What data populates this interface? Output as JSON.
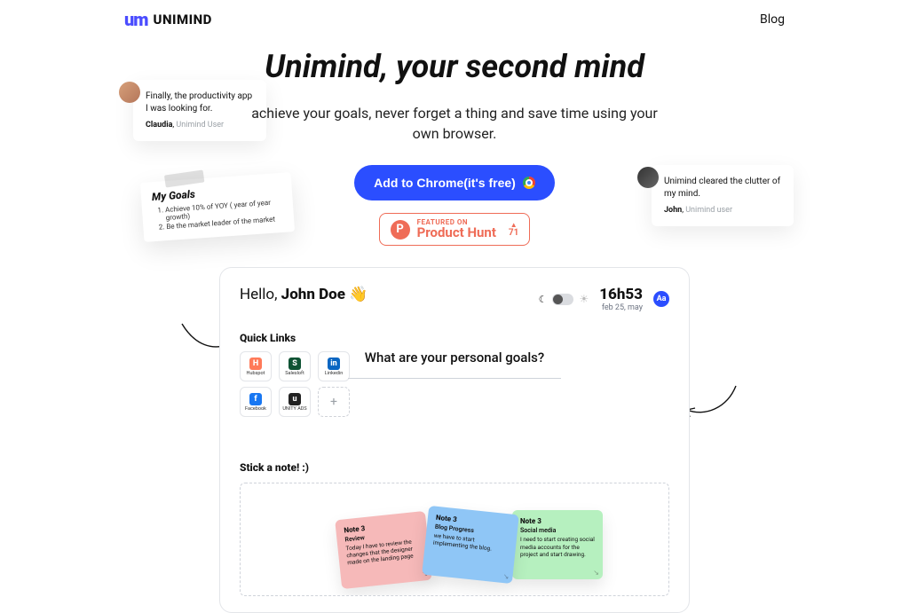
{
  "brand": {
    "icon": "um",
    "name": "UNIMIND"
  },
  "nav": {
    "blog": "Blog"
  },
  "hero": {
    "title": "Unimind, your second mind",
    "subtitle": "achieve your goals, never forget a thing and save time using your own browser.",
    "cta_label": "Add to Chrome(it's free)"
  },
  "product_hunt": {
    "featured_label": "FEATURED ON",
    "name": "Product Hunt",
    "votes": "71",
    "p": "P"
  },
  "testimonial_left": {
    "quote": "Finally, the productivity app I was looking for.",
    "author": "Claudia",
    "role": "Unimind User"
  },
  "testimonial_right": {
    "quote": "Unimind cleared the clutter of my mind.",
    "author": "John",
    "role": "Unimind user"
  },
  "goals_card": {
    "title": "My Goals",
    "items": [
      "Achieve 10% of YOY ( year of year growth)",
      "Be the market leader of the market"
    ]
  },
  "app": {
    "greeting_prefix": "Hello, ",
    "user_name": "John Doe",
    "wave": "👋",
    "time": "16h53",
    "date": "feb 25, may",
    "aa": "Aa",
    "quick_links_title": "Quick Links",
    "quick_links": [
      {
        "label": "Hubspot",
        "initial": "H",
        "color": "#ff7a59"
      },
      {
        "label": "Salesloft",
        "initial": "S",
        "color": "#0f5334"
      },
      {
        "label": "Linkedin",
        "initial": "in",
        "color": "#0a66c2"
      },
      {
        "label": "Facebook",
        "initial": "f",
        "color": "#1877f2"
      },
      {
        "label": "UNITY ADS",
        "initial": "u",
        "color": "#222"
      }
    ],
    "goals_question": "What are your personal goals?",
    "stick_title": "Stick a note! :)",
    "notes": [
      {
        "title": "Note 3",
        "subject": "Review",
        "body": "Today I have to review the changes that the designer made on the landing page"
      },
      {
        "title": "Note 3",
        "subject": "Blog Progress",
        "body": "we have to start implementing the blog."
      },
      {
        "title": "Note 3",
        "subject": "Social media",
        "body": "I need to start creating social media accounts for the project and start drawing."
      }
    ]
  }
}
